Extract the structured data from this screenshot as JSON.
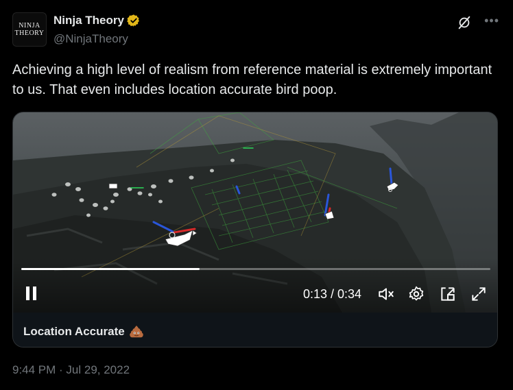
{
  "author": {
    "avatar_line1": "NINJA",
    "avatar_line2": "THEORY",
    "display_name": "Ninja Theory",
    "handle": "@NinjaTheory",
    "verified": true
  },
  "tweet": {
    "text": "Achieving a high level of realism from reference material is extremely important to us. That even includes location accurate bird poop.",
    "timestamp": "9:44 PM · Jul 29, 2022"
  },
  "video": {
    "time": "0:13 / 0:34",
    "progress": 0.38,
    "caption": "Location Accurate"
  },
  "colors": {
    "background": "#000000",
    "text": "#e7e9ea",
    "muted": "#71767b",
    "verified_gold": "#e2b719",
    "border": "#2f3336"
  },
  "icons": [
    "grok-icon",
    "more-icon",
    "verified-badge-icon",
    "pause-icon",
    "mute-icon",
    "settings-icon",
    "picture-in-picture-icon",
    "fullscreen-icon",
    "poop-icon"
  ]
}
